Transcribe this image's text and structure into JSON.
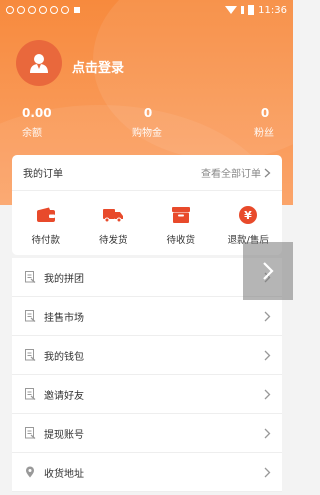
{
  "status_bar": {
    "time": "11:36"
  },
  "profile": {
    "login_label": "点击登录"
  },
  "stats": [
    {
      "value": "0.00",
      "label": "余额"
    },
    {
      "value": "0",
      "label": "购物金"
    },
    {
      "value": "0",
      "label": "粉丝"
    }
  ],
  "orders": {
    "title": "我的订单",
    "view_all": "查看全部订单",
    "items": [
      {
        "label": "待付款",
        "icon": "wallet-icon"
      },
      {
        "label": "待发货",
        "icon": "truck-icon"
      },
      {
        "label": "待收货",
        "icon": "package-icon"
      },
      {
        "label": "退款/售后",
        "icon": "yen-icon"
      }
    ]
  },
  "menu": [
    {
      "label": "我的拼团",
      "icon": "document-icon"
    },
    {
      "label": "挂售市场",
      "icon": "document-icon"
    },
    {
      "label": "我的钱包",
      "icon": "document-icon"
    },
    {
      "label": "邀请好友",
      "icon": "document-icon"
    },
    {
      "label": "提现账号",
      "icon": "document-icon"
    },
    {
      "label": "收货地址",
      "icon": "location-pin-icon"
    }
  ],
  "colors": {
    "accent": "#f78a3d",
    "accent_dark": "#e9683c",
    "icon_red": "#e84a2b"
  }
}
